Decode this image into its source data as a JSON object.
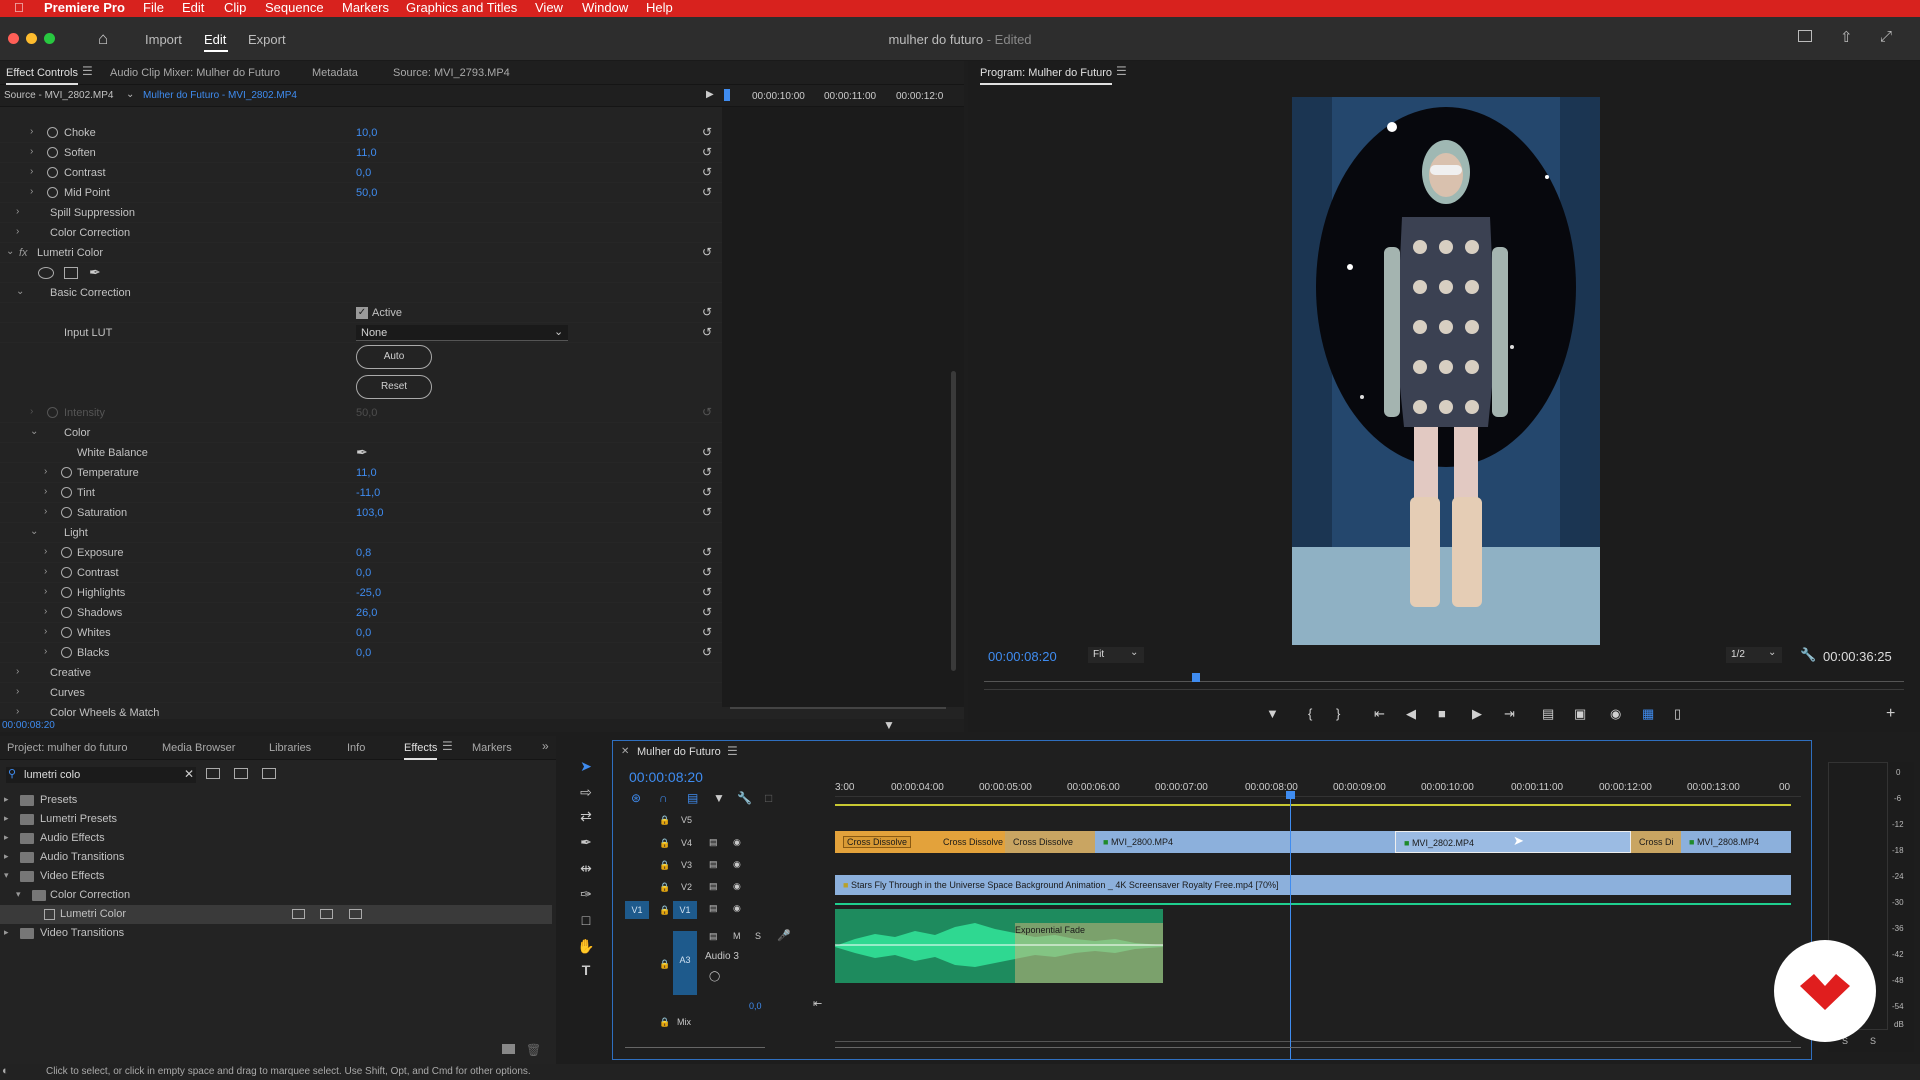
{
  "menubar": {
    "app": "Premiere Pro",
    "items": [
      "File",
      "Edit",
      "Clip",
      "Sequence",
      "Markers",
      "Graphics and Titles",
      "View",
      "Window",
      "Help"
    ]
  },
  "titlebar": {
    "workspaces": [
      "Import",
      "Edit",
      "Export"
    ],
    "title": "mulher do futuro",
    "status": "- Edited"
  },
  "effect_controls": {
    "tabs": [
      "Effect Controls",
      "Audio Clip Mixer: Mulher do Futuro",
      "Metadata",
      "Source: MVI_2793.MP4"
    ],
    "source_label": "Source - MVI_2802.MP4",
    "clip_label": "Mulher do Futuro - MVI_2802.MP4",
    "ruler": [
      "00:00:10:00",
      "00:00:11:00",
      "00:00:12:0"
    ],
    "rows": [
      {
        "label": "Choke",
        "value": "10,0"
      },
      {
        "label": "Soften",
        "value": "11,0"
      },
      {
        "label": "Contrast",
        "value": "0,0"
      },
      {
        "label": "Mid Point",
        "value": "50,0"
      },
      {
        "label": "Spill Suppression"
      },
      {
        "label": "Color Correction"
      },
      {
        "label": "Lumetri Color"
      },
      {
        "label": "Basic Correction"
      },
      {
        "label": "Active"
      },
      {
        "label": "Input LUT",
        "value": "None"
      },
      {
        "label": "Auto"
      },
      {
        "label": "Reset"
      },
      {
        "label": "Intensity",
        "value": "50,0"
      },
      {
        "label": "Color"
      },
      {
        "label": "White Balance"
      },
      {
        "label": "Temperature",
        "value": "11,0"
      },
      {
        "label": "Tint",
        "value": "-11,0"
      },
      {
        "label": "Saturation",
        "value": "103,0"
      },
      {
        "label": "Light"
      },
      {
        "label": "Exposure",
        "value": "0,8"
      },
      {
        "label": "Contrast",
        "value": "0,0"
      },
      {
        "label": "Highlights",
        "value": "-25,0"
      },
      {
        "label": "Shadows",
        "value": "26,0"
      },
      {
        "label": "Whites",
        "value": "0,0"
      },
      {
        "label": "Blacks",
        "value": "0,0"
      },
      {
        "label": "Creative"
      },
      {
        "label": "Curves"
      },
      {
        "label": "Color Wheels & Match"
      }
    ],
    "fx_label": "fx",
    "timecode": "00:00:08:20"
  },
  "program": {
    "tab": "Program: Mulher do Futuro",
    "timecode": "00:00:08:20",
    "fit": "Fit",
    "resolution": "1/2",
    "duration": "00:00:36:25"
  },
  "project": {
    "tabs": [
      "Project: mulher do futuro",
      "Media Browser",
      "Libraries",
      "Info",
      "Effects",
      "Markers"
    ],
    "search_value": "lumetri colo",
    "tree": [
      "Presets",
      "Lumetri Presets",
      "Audio Effects",
      "Audio Transitions",
      "Video Effects",
      "Color Correction",
      "Lumetri Color",
      "Video Transitions"
    ]
  },
  "timeline": {
    "tab": "Mulher do Futuro",
    "timecode": "00:00:08:20",
    "ruler": [
      "3:00",
      "00:00:04:00",
      "00:00:05:00",
      "00:00:06:00",
      "00:00:07:00",
      "00:00:08:00",
      "00:00:09:00",
      "00:00:10:00",
      "00:00:11:00",
      "00:00:12:00",
      "00:00:13:00",
      "00"
    ],
    "tracks": [
      "V5",
      "V4",
      "V3",
      "V2",
      "V1",
      "A3"
    ],
    "source_patch": "V1",
    "audio_track_name": "Audio 3",
    "audio_level": "0,0",
    "mix_label": "Mix",
    "clips": {
      "cd1": "Cross Dissolve",
      "cd2": "Cross Dissolve",
      "cd3": "Cross Dissolve",
      "v1": "MVI_2800.MP4",
      "v2": "MVI_2802.MP4",
      "v2b": "Cross Di",
      "v3": "MVI_2808.MP4",
      "bg": "Stars Fly Through in the Universe Space Background Animation _ 4K Screensaver Royalty Free.mp4 [70%]",
      "fade": "Exponential Fade"
    }
  },
  "meter": {
    "scale": [
      "0",
      "-6",
      "-12",
      "-18",
      "-24",
      "-30",
      "-36",
      "-42",
      "-48",
      "-54",
      "dB"
    ],
    "buttons": [
      "S",
      "S"
    ]
  },
  "status_bar": "Click to select, or click in empty space and drag to marquee select. Use Shift, Opt, and Cmd for other options."
}
